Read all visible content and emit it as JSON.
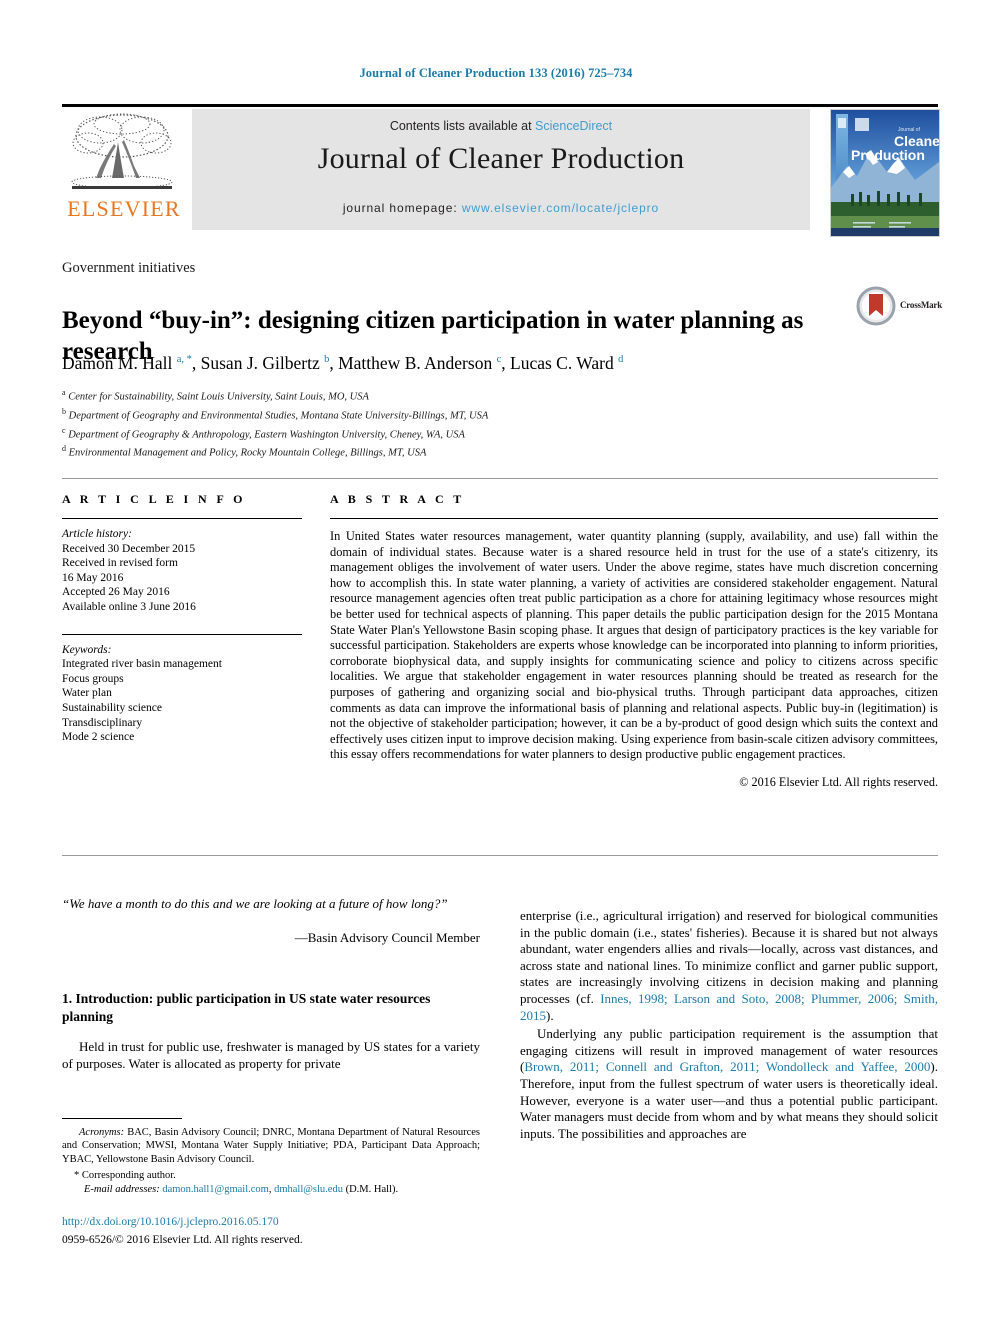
{
  "running_head": "Journal of Cleaner Production 133 (2016) 725–734",
  "masthead": {
    "publisher_name": "ELSEVIER",
    "contents_prefix": "Contents lists available at ",
    "contents_link": "ScienceDirect",
    "journal_name": "Journal of Cleaner Production",
    "homepage_prefix": "journal homepage: ",
    "homepage_url": "www.elsevier.com/locate/jclepro",
    "cover_title_small": "Journal of",
    "cover_title_line1": "Cleaner",
    "cover_title_line2": "Production"
  },
  "article": {
    "section_label": "Government initiatives",
    "title": "Beyond “buy-in”: designing citizen participation in water planning as research",
    "crossmark_label": "CrossMark",
    "authors_html": "Damon M. Hall <sup>a, *</sup>, Susan J. Gilbertz <sup>b</sup>, Matthew B. Anderson <sup>c</sup>, Lucas C. Ward <sup>d</sup>",
    "affiliations": [
      {
        "marker": "a",
        "text": "Center for Sustainability, Saint Louis University, Saint Louis, MO, USA"
      },
      {
        "marker": "b",
        "text": "Department of Geography and Environmental Studies, Montana State University-Billings, MT, USA"
      },
      {
        "marker": "c",
        "text": "Department of Geography & Anthropology, Eastern Washington University, Cheney, WA, USA"
      },
      {
        "marker": "d",
        "text": "Environmental Management and Policy, Rocky Mountain College, Billings, MT, USA"
      }
    ]
  },
  "info": {
    "heading": "A R T I C L E   I N F O",
    "history_label": "Article history:",
    "history": [
      "Received 30 December 2015",
      "Received in revised form",
      "16 May 2016",
      "Accepted 26 May 2016",
      "Available online 3 June 2016"
    ],
    "keywords_label": "Keywords:",
    "keywords": [
      "Integrated river basin management",
      "Focus groups",
      "Water plan",
      "Sustainability science",
      "Transdisciplinary",
      "Mode 2 science"
    ]
  },
  "abstract": {
    "heading": "A B S T R A C T",
    "text": "In United States water resources management, water quantity planning (supply, availability, and use) fall within the domain of individual states. Because water is a shared resource held in trust for the use of a state's citizenry, its management obliges the involvement of water users. Under the above regime, states have much discretion concerning how to accomplish this. In state water planning, a variety of activities are considered stakeholder engagement. Natural resource management agencies often treat public participation as a chore for attaining legitimacy whose resources might be better used for technical aspects of planning. This paper details the public participation design for the 2015 Montana State Water Plan's Yellowstone Basin scoping phase. It argues that design of participatory practices is the key variable for successful participation. Stakeholders are experts whose knowledge can be incorporated into planning to inform priorities, corroborate biophysical data, and supply insights for communicating science and policy to citizens across specific localities. We argue that stakeholder engagement in water resources planning should be treated as research for the purposes of gathering and organizing social and bio-physical truths. Through participant data approaches, citizen comments as data can improve the informational basis of planning and relational aspects. Public buy-in (legitimation) is not the objective of stakeholder participation; however, it can be a by-product of good design which suits the context and effectively uses citizen input to improve decision making. Using experience from basin-scale citizen advisory committees, this essay offers recommendations for water planners to design productive public engagement practices.",
    "copyright": "© 2016 Elsevier Ltd. All rights reserved."
  },
  "body": {
    "epigraph": "“We have a month to do this and we are looking at a future of how long?”",
    "epigraph_attribution": "—Basin Advisory Council Member",
    "section_heading": "1. Introduction: public participation in US state water resources planning",
    "left_paragraph": "Held in trust for public use, freshwater is managed by US states for a variety of purposes. Water is allocated as property for private",
    "right_paragraph_1_pre": "enterprise (i.e., agricultural irrigation) and reserved for biological communities in the public domain (i.e., states' fisheries). Because it is shared but not always abundant, water engenders allies and rivals—locally, across vast distances, and across state and national lines. To minimize conflict and garner public support, states are increasingly involving citizens in decision making and planning processes (cf. ",
    "right_paragraph_1_cite": "Innes, 1998; Larson and Soto, 2008; Plummer, 2006; Smith, 2015",
    "right_paragraph_1_post": ").",
    "right_paragraph_2_pre": "Underlying any public participation requirement is the assumption that engaging citizens will result in improved management of water resources (",
    "right_paragraph_2_cite": "Brown, 2011; Connell and Grafton, 2011; Wondolleck and Yaffee, 2000",
    "right_paragraph_2_post": "). Therefore, input from the fullest spectrum of water users is theoretically ideal. However, everyone is a water user—and thus a potential public participant. Water managers must decide from whom and by what means they should solicit inputs. The possibilities and approaches are"
  },
  "footnotes": {
    "acronyms_label": "Acronyms:",
    "acronyms_text": " BAC, Basin Advisory Council; DNRC, Montana Department of Natural Resources and Conservation; MWSI, Montana Water Supply Initiative; PDA, Participant Data Approach; YBAC, Yellowstone Basin Advisory Council.",
    "corresponding": "* Corresponding author.",
    "email_label": "E-mail addresses:",
    "email_1": "damon.hall1@gmail.com",
    "email_2": "dmhall@slu.edu",
    "email_suffix": " (D.M. Hall).",
    "doi": "http://dx.doi.org/10.1016/j.jclepro.2016.05.170",
    "issn": "0959-6526/© 2016 Elsevier Ltd. All rights reserved."
  },
  "colors": {
    "link_blue": "#1b7ba8",
    "science_direct_blue": "#3f9dd0",
    "elsevier_orange": "#e87722",
    "band_gray": "#e4e4e4"
  }
}
